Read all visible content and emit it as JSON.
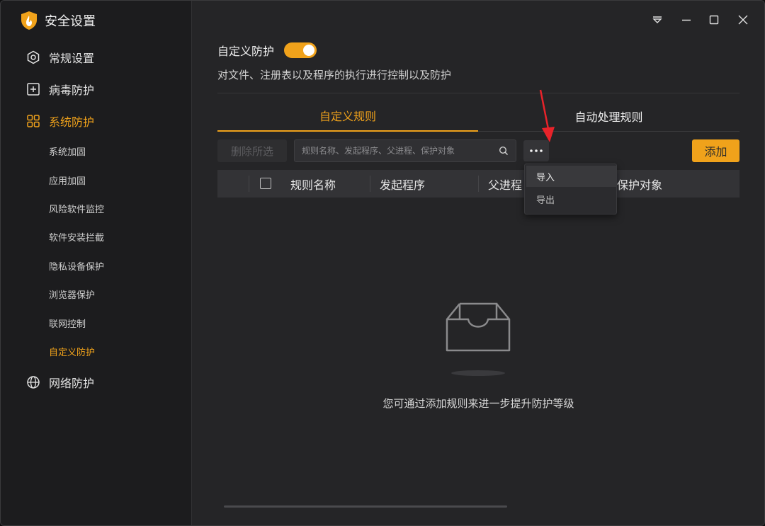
{
  "app": {
    "title": "安全设置"
  },
  "sidebar": {
    "items": [
      {
        "label": "常规设置"
      },
      {
        "label": "病毒防护"
      },
      {
        "label": "系统防护"
      },
      {
        "label": "网络防护"
      }
    ],
    "sub_items": [
      {
        "label": "系统加固"
      },
      {
        "label": "应用加固"
      },
      {
        "label": "风险软件监控"
      },
      {
        "label": "软件安装拦截"
      },
      {
        "label": "隐私设备保护"
      },
      {
        "label": "浏览器保护"
      },
      {
        "label": "联网控制"
      },
      {
        "label": "自定义防护"
      }
    ]
  },
  "main": {
    "section_title": "自定义防护",
    "toggle_on": true,
    "description": "对文件、注册表以及程序的执行进行控制以及防护",
    "tabs": [
      {
        "label": "自定义规则"
      },
      {
        "label": "自动处理规则"
      }
    ],
    "toolbar": {
      "delete_selected": "删除所选",
      "search_placeholder": "规则名称、发起程序、父进程、保护对象",
      "more_label": "···",
      "add": "添加"
    },
    "table": {
      "columns": [
        "规则名称",
        "发起程序",
        "父进程",
        "保护对象"
      ]
    },
    "dropdown": {
      "items": [
        {
          "label": "导入"
        },
        {
          "label": "导出"
        }
      ]
    },
    "empty_message": "您可通过添加规则来进一步提升防护等级"
  },
  "colors": {
    "accent": "#f0a21b",
    "window_bg": "#252527",
    "sidebar_bg": "#1c1c1e",
    "annotation_arrow": "#e8232a"
  },
  "icons": [
    "shield-logo-icon",
    "gear-icon",
    "plus-square-icon",
    "grid-icon",
    "globe-icon",
    "search-icon",
    "ellipsis-icon",
    "minimize-icon",
    "maximize-icon",
    "close-icon",
    "menu-icon",
    "inbox-icon"
  ]
}
